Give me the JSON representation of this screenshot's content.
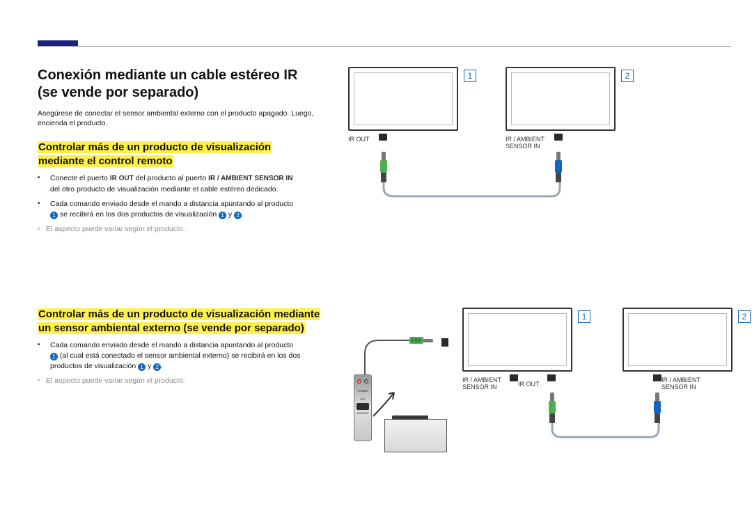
{
  "title_line1": "Conexión mediante un cable estéreo IR",
  "title_line2": "(se vende por separado)",
  "intro": "Asegúrese de conectar el sensor ambiental externo con el producto apagado. Luego, encienda el producto.",
  "h2a_line1": "Controlar más de un producto de visualización",
  "h2a_line2": "mediante el control remoto",
  "bullet_a1_prefix": "Conecte el puerto ",
  "bullet_a1_port1": "IR OUT",
  "bullet_a1_mid": " del producto al puerto ",
  "bullet_a1_port2": "IR / AMBIENT SENSOR IN",
  "bullet_a1_line2": "del otro producto de visualización mediante el cable estéreo dedicado.",
  "bullet_a2_prefix": "Cada comando enviado desde el mando a distancia apuntando al producto",
  "bullet_a2_mid1": " se recibirá en los dos productos de visualización ",
  "bullet_a2_y": " y ",
  "bullet_a2_end": ".",
  "note_text": "El aspecto puede variar según el producto.",
  "h2b_line1": "Controlar más de un producto de visualización mediante",
  "h2b_line2": "un sensor ambiental externo (se vende por separado)",
  "bullet_b1_prefix": "Cada comando enviado desde el mando a distancia apuntando al producto",
  "bullet_b1_mid1": " (al cual está conectado el sensor ambiental externo) se recibirá en los dos productos de visualización ",
  "bullet_b1_y": " y ",
  "bullet_b1_end": ".",
  "marker": "•",
  "labels": {
    "ir_out": "IR OUT",
    "ir_ambient": "IR / AMBIENT",
    "sensor_in": "SENSOR IN"
  },
  "badge1": "1",
  "badge2": "2",
  "remote_power": "POWER",
  "remote_off": "OFF",
  "remote_source": "SOURCE"
}
